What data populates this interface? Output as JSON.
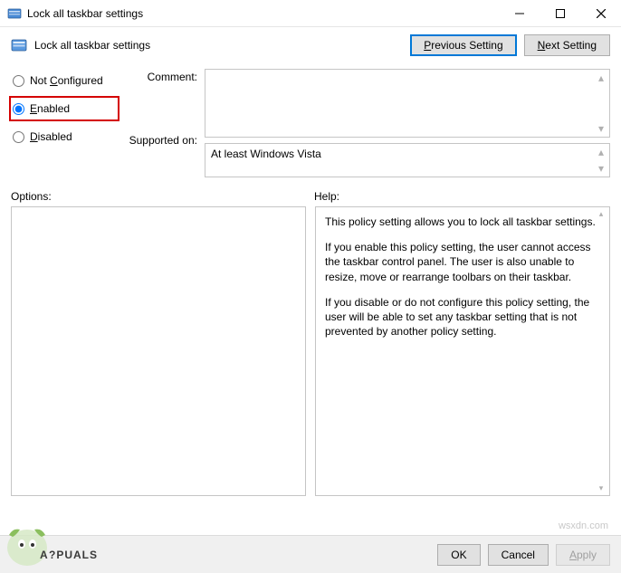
{
  "window": {
    "title": "Lock all taskbar settings"
  },
  "header": {
    "policy_title": "Lock all taskbar settings",
    "prev_button": "Previous Setting",
    "next_button": "Next Setting"
  },
  "radios": {
    "not_configured": "Not Configured",
    "enabled": "Enabled",
    "disabled": "Disabled",
    "selected": "enabled"
  },
  "labels": {
    "comment": "Comment:",
    "supported": "Supported on:",
    "options": "Options:",
    "help": "Help:"
  },
  "fields": {
    "comment_value": "",
    "supported_value": "At least Windows Vista"
  },
  "help": {
    "p1": "This policy setting allows you to lock all taskbar settings.",
    "p2": "If you enable this policy setting, the user cannot access the taskbar control panel. The user is also unable to resize, move or rearrange toolbars on their taskbar.",
    "p3": "If you disable or do not configure this policy setting, the user will be able to set any taskbar setting that is not prevented by another policy setting."
  },
  "footer": {
    "ok": "OK",
    "cancel": "Cancel",
    "apply": "Apply"
  },
  "watermark": {
    "text": "A?PUALS",
    "source": "wsxdn.com"
  }
}
